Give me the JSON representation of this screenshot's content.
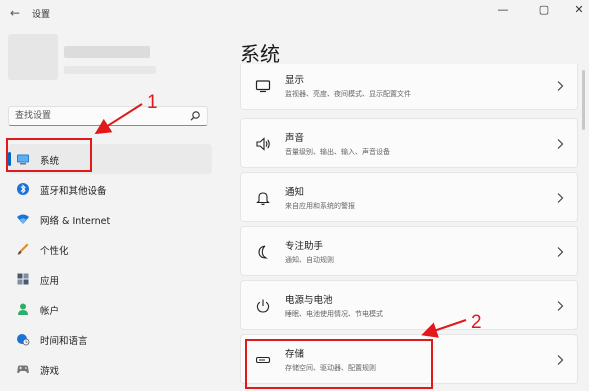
{
  "window": {
    "title": "设置",
    "controls": {
      "minimize": "—",
      "maximize": "▢",
      "close": "✕"
    }
  },
  "search": {
    "placeholder": "查找设置"
  },
  "sidebar": {
    "items": [
      {
        "label": "系统",
        "icon": "monitor-icon",
        "active": true
      },
      {
        "label": "蓝牙和其他设备",
        "icon": "bluetooth-icon"
      },
      {
        "label": "网络 & Internet",
        "icon": "wifi-icon"
      },
      {
        "label": "个性化",
        "icon": "brush-icon"
      },
      {
        "label": "应用",
        "icon": "apps-icon"
      },
      {
        "label": "帐户",
        "icon": "person-icon"
      },
      {
        "label": "时间和语言",
        "icon": "globe-clock-icon"
      },
      {
        "label": "游戏",
        "icon": "gamepad-icon"
      }
    ]
  },
  "main": {
    "title": "系统",
    "cards": [
      {
        "title": "显示",
        "desc": "监视器、亮度、夜间模式、显示配置文件",
        "icon": "display-icon"
      },
      {
        "title": "声音",
        "desc": "音量级别、输出、输入、声音设备",
        "icon": "speaker-icon"
      },
      {
        "title": "通知",
        "desc": "来自应用和系统的警报",
        "icon": "bell-icon"
      },
      {
        "title": "专注助手",
        "desc": "通知、自动规则",
        "icon": "moon-icon"
      },
      {
        "title": "电源与电池",
        "desc": "睡眠、电池使用情况、节电模式",
        "icon": "power-icon"
      },
      {
        "title": "存储",
        "desc": "存储空间、驱动器、配置规则",
        "icon": "storage-icon"
      }
    ]
  },
  "annotations": [
    {
      "number": "1",
      "target": "系统"
    },
    {
      "number": "2",
      "target": "存储"
    }
  ],
  "colors": {
    "accent": "#0067c0",
    "annotation": "#e0191b"
  }
}
